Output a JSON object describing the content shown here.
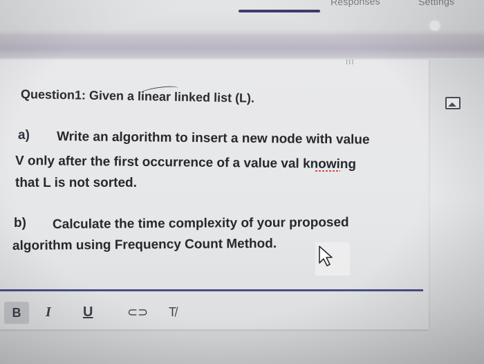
{
  "tabs": {
    "responses": "Responses",
    "settings": "Settings"
  },
  "question": {
    "title": "Question1: Given a linear linked list (L).",
    "part_a_label": "a)",
    "part_a_line1": "Write an algorithm to insert a new node with value",
    "part_a_line2": "V only after the first occurrence of a value val knowing",
    "part_a_line3": "that L is not sorted.",
    "part_b_label": "b)",
    "part_b_line1": "Calculate the time complexity of your proposed",
    "part_b_line2": "algorithm using Frequency Count Method."
  },
  "toolbar": {
    "bold": "B",
    "italic": "I",
    "underline": "U",
    "link": "⊂⊃",
    "clear_format": "T̸"
  },
  "drag_handle": "⁝⁝⁝",
  "colors": {
    "accent_tab_underline": "#3f3b6c",
    "answer_line": "#4a4d86",
    "spellcheck": "#d44b4b"
  },
  "icons": [
    "drag-handle-icon",
    "image-icon",
    "mouse-cursor-icon",
    "bold-icon",
    "italic-icon",
    "underline-icon",
    "link-icon",
    "clear-format-icon"
  ]
}
